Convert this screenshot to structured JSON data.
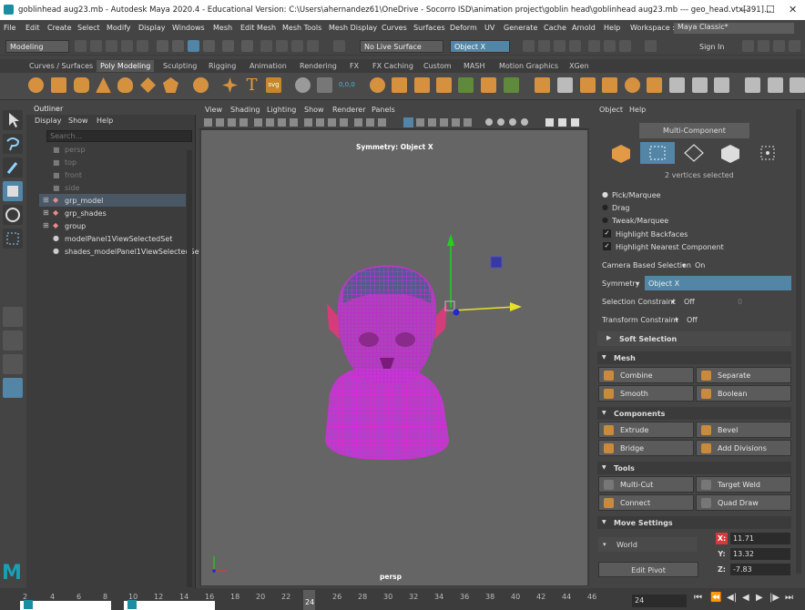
{
  "window": {
    "title": "goblinhead aug23.mb - Autodesk Maya 2020.4 - Educational Version: C:\\Users\\ahernandez61\\OneDrive - Socorro ISD\\animation project\\goblin head\\goblinhead aug23.mb --- geo_head.vtx[391]...",
    "min": "—",
    "max": "☐",
    "close": "✕"
  },
  "menubar": [
    "File",
    "Edit",
    "Create",
    "Select",
    "Modify",
    "Display",
    "Windows",
    "Mesh",
    "Edit Mesh",
    "Mesh Tools",
    "Mesh Display",
    "Curves",
    "Surfaces",
    "Deform",
    "UV",
    "Generate",
    "Cache",
    "Arnold",
    "Help"
  ],
  "workspace": {
    "label": "Workspace :",
    "value": "Maya Classic*"
  },
  "status": {
    "mode": "Modeling",
    "live_surface": "No Live Surface",
    "symmetry": "Object X",
    "sign_in": "Sign In"
  },
  "shelf_tabs": [
    "Curves / Surfaces",
    "Poly Modeling",
    "Sculpting",
    "Rigging",
    "Animation",
    "Rendering",
    "FX",
    "FX Caching",
    "Custom",
    "MASH",
    "Motion Graphics",
    "XGen"
  ],
  "outliner": {
    "title": "Outliner",
    "menu": [
      "Display",
      "Show",
      "Help"
    ],
    "search_placeholder": "Search...",
    "cameras": [
      "persp",
      "top",
      "front",
      "side"
    ],
    "groups": [
      "grp_model",
      "grp_shades",
      "group"
    ],
    "sets": [
      "modelPanel1ViewSelectedSet",
      "shades_modelPanel1ViewSelectedSet"
    ]
  },
  "viewport": {
    "menu": [
      "View",
      "Shading",
      "Lighting",
      "Show",
      "Renderer",
      "Panels"
    ],
    "symmetry_label": "Symmetry: Object X",
    "camera_label": "persp"
  },
  "attr": {
    "menu": [
      "Object",
      "Help"
    ],
    "tool_title": "Multi-Component",
    "selected_info": "2 vertices selected",
    "pick_options": [
      "Pick/Marquee",
      "Drag",
      "Tweak/Marquee"
    ],
    "highlight_backfaces": "Highlight Backfaces",
    "highlight_nearest": "Highlight Nearest Component",
    "camera_based_label": "Camera Based Selection",
    "camera_based_value": "On",
    "symmetry_label": "Symmetry",
    "symmetry_value": "Object X",
    "selection_constraint_label": "Selection Constraint",
    "selection_constraint_value": "Off",
    "selection_constraint_num": "0",
    "transform_constraint_label": "Transform Constraint",
    "transform_constraint_value": "Off",
    "soft_selection": "Soft Selection",
    "sections": {
      "mesh": "Mesh",
      "components": "Components",
      "tools": "Tools",
      "move": "Move Settings"
    },
    "mesh_buttons": [
      "Combine",
      "Separate",
      "Smooth",
      "Boolean"
    ],
    "component_buttons": [
      "Extrude",
      "Bevel",
      "Bridge",
      "Add Divisions"
    ],
    "tool_buttons": [
      "Multi-Cut",
      "Target Weld",
      "Connect",
      "Quad Draw"
    ],
    "world": "World",
    "edit_pivot": "Edit Pivot",
    "x_label": "X:",
    "x_value": "11.71",
    "y_label": "Y:",
    "y_value": "13.32",
    "z_label": "Z:",
    "z_value": "-7.83"
  },
  "timeline": {
    "ticks": [
      "2",
      "4",
      "6",
      "8",
      "10",
      "12",
      "14",
      "16",
      "18",
      "20",
      "22",
      "24",
      "26",
      "28",
      "30",
      "32",
      "34",
      "36",
      "38",
      "40",
      "42",
      "44",
      "46"
    ],
    "current_frame": "24",
    "frame_field": "24"
  },
  "colors": {
    "accent": "#5285a6",
    "wire": "#e51be5",
    "gizmo_y": "#1fd21f",
    "gizmo_x": "#e8e02a",
    "gizmo_z": "#2424d8"
  }
}
